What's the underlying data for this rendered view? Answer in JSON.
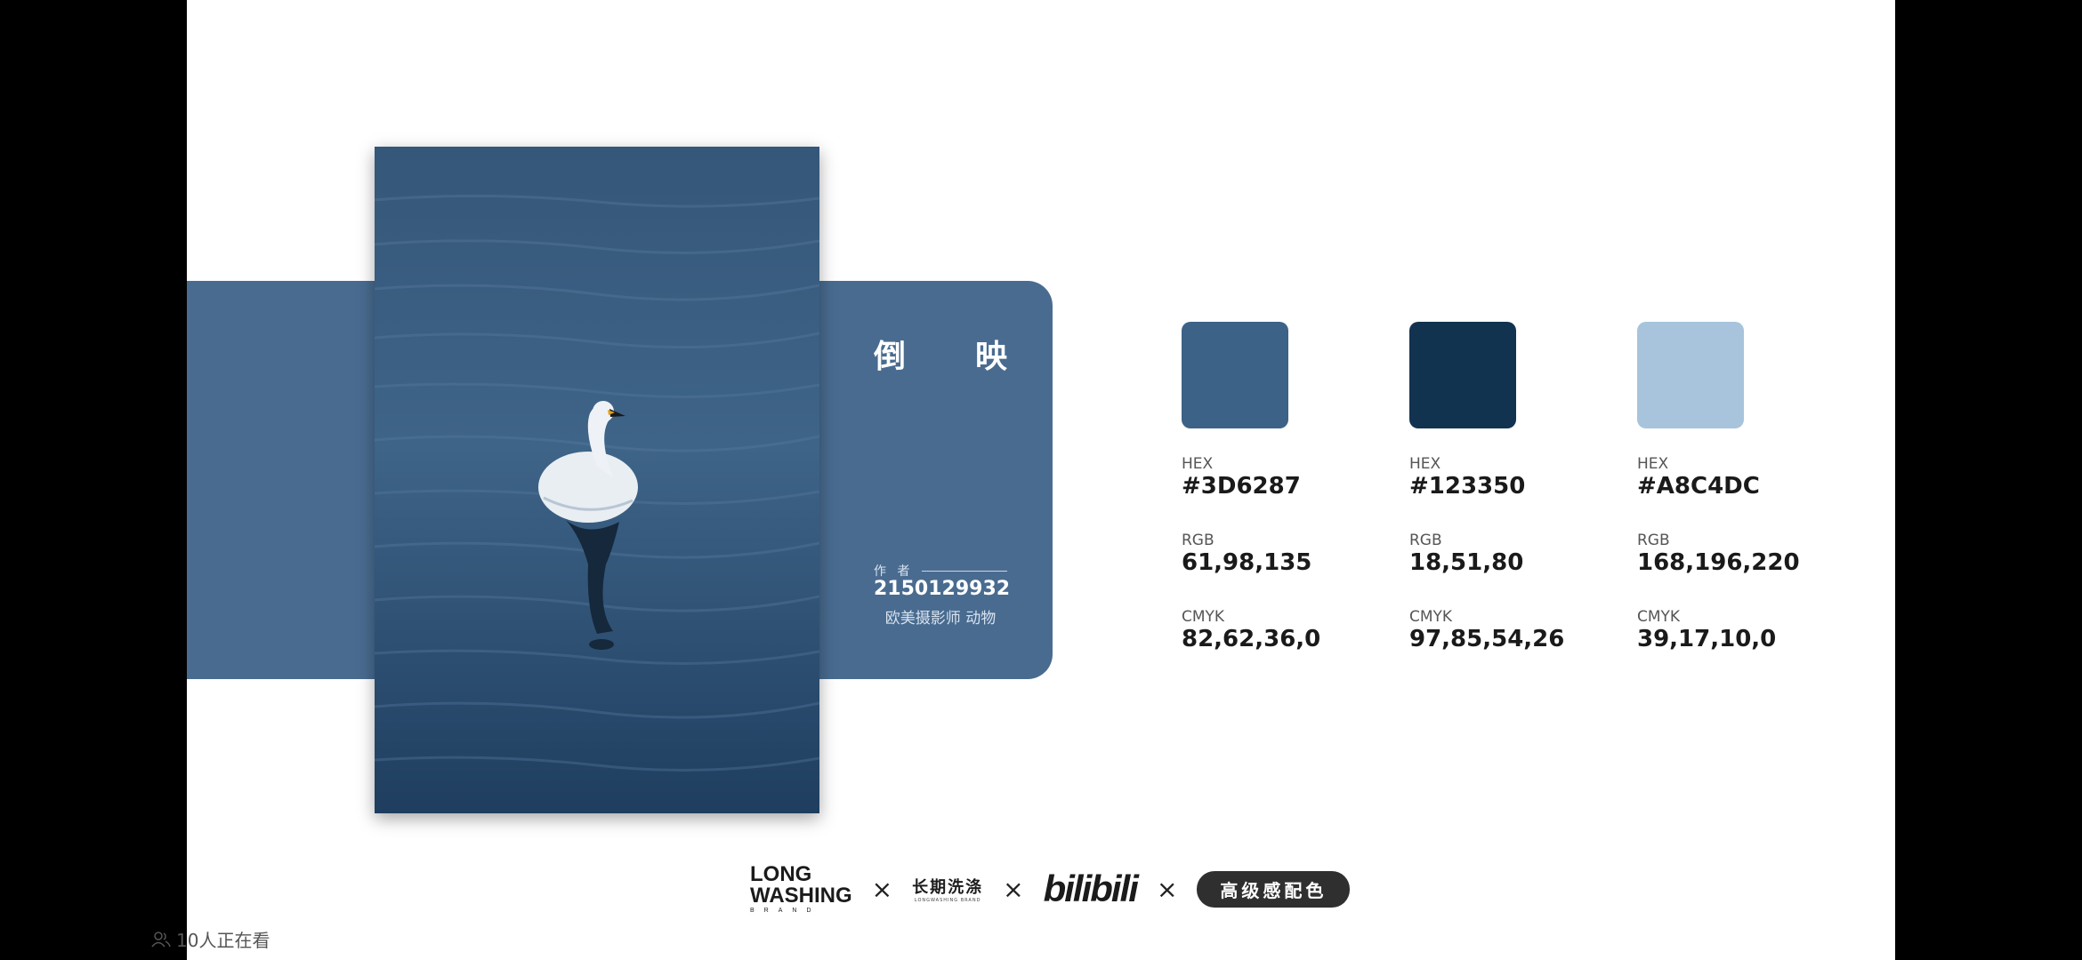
{
  "card": {
    "title_chars": [
      "倒",
      "映"
    ],
    "author_label": "作 者",
    "author_id": "2150129932",
    "author_tags": "欧美摄影师 动物",
    "band_color": "#496b90"
  },
  "palette": [
    {
      "color": "#3D6287",
      "hex_label": "HEX",
      "hex": "#3D6287",
      "rgb_label": "RGB",
      "rgb": "61,98,135",
      "cmyk_label": "CMYK",
      "cmyk": "82,62,36,0"
    },
    {
      "color": "#123350",
      "hex_label": "HEX",
      "hex": "#123350",
      "rgb_label": "RGB",
      "rgb": "18,51,80",
      "cmyk_label": "CMYK",
      "cmyk": "97,85,54,26"
    },
    {
      "color": "#A8C4DC",
      "hex_label": "HEX",
      "hex": "#A8C4DC",
      "rgb_label": "RGB",
      "rgb": "168,196,220",
      "cmyk_label": "CMYK",
      "cmyk": "39,17,10,0"
    }
  ],
  "footer": {
    "lw_line1": "LONG",
    "lw_line2": "WASHING",
    "lw_brand": "BRAND",
    "cn_main": "长期洗涤",
    "cn_sub": "LONGWASHING BRAND",
    "bili": "bilibili",
    "pill": "高级感配色",
    "times": "×"
  },
  "overlay": {
    "viewers": "10人正在看",
    "viewers_icon": "people-icon"
  }
}
